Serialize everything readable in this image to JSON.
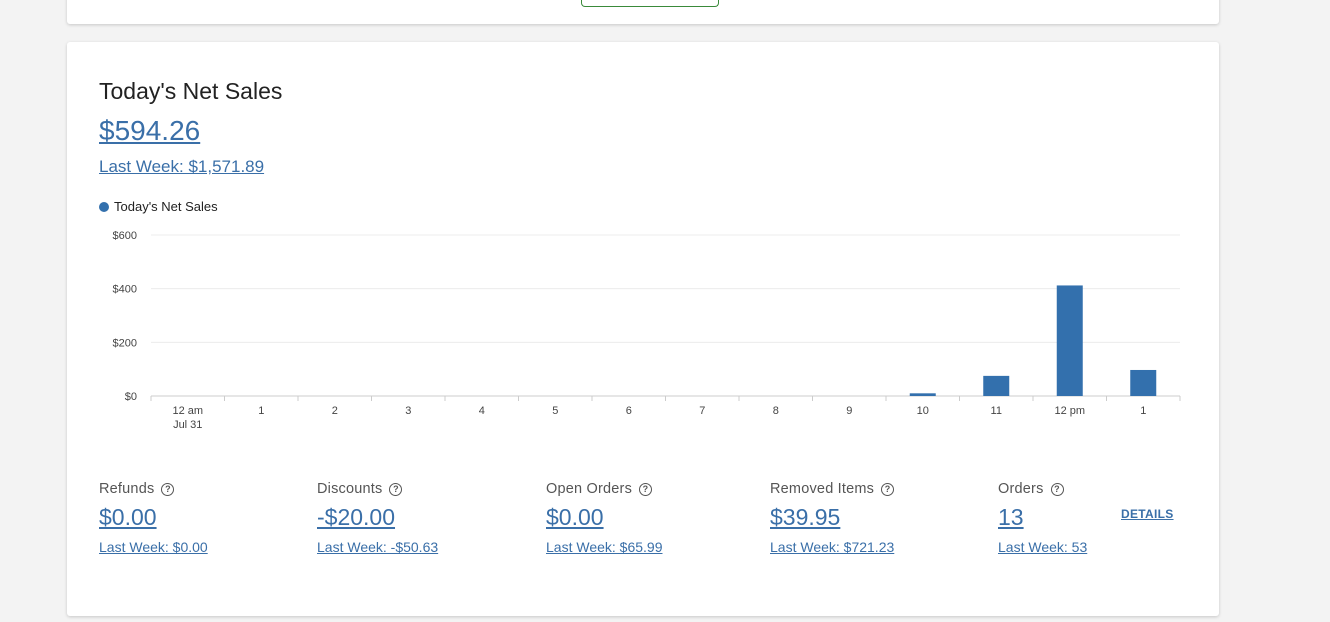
{
  "colors": {
    "accent": "#3a6fa8",
    "bar": "#3370ad",
    "button_border": "#3a8a3a"
  },
  "net_sales": {
    "title": "Today's Net Sales",
    "value": "$594.26",
    "last_week": "Last Week: $1,571.89"
  },
  "chart_data": {
    "type": "bar",
    "legend": {
      "label": "Today's Net Sales",
      "placement": "top-left"
    },
    "categories": [
      "12 am",
      "1",
      "2",
      "3",
      "4",
      "5",
      "6",
      "7",
      "8",
      "9",
      "10",
      "11",
      "12 pm",
      "1"
    ],
    "category_sublabels": [
      "Jul 31",
      "",
      "",
      "",
      "",
      "",
      "",
      "",
      "",
      "",
      "",
      "",
      "",
      ""
    ],
    "series": [
      {
        "name": "Today's Net Sales",
        "values": [
          0,
          0,
          0,
          0,
          0,
          0,
          0,
          0,
          0,
          0,
          10,
          75,
          412,
          97
        ]
      }
    ],
    "y_ticks": [
      0,
      200,
      400,
      600
    ],
    "y_tick_labels": [
      "$0",
      "$200",
      "$400",
      "$600"
    ],
    "ylim": [
      0,
      600
    ],
    "grid": true
  },
  "stats": [
    {
      "label": "Refunds",
      "value": "$0.00",
      "last_week": "Last Week: $0.00"
    },
    {
      "label": "Discounts",
      "value": "-$20.00",
      "last_week": "Last Week: -$50.63"
    },
    {
      "label": "Open Orders",
      "value": "$0.00",
      "last_week": "Last Week: $65.99"
    },
    {
      "label": "Removed Items",
      "value": "$39.95",
      "last_week": "Last Week: $721.23"
    },
    {
      "label": "Orders",
      "value": "13",
      "last_week": "Last Week: 53"
    }
  ],
  "details_label": "DETAILS",
  "help_icon": "question-circle-icon"
}
